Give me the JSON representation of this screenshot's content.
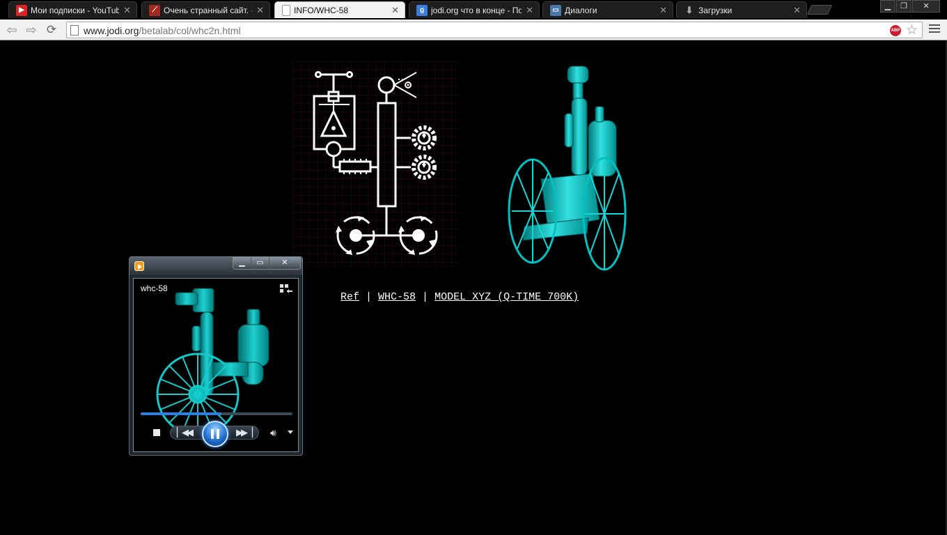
{
  "browser": {
    "tabs": [
      {
        "title": "Мои подписки - YouTube",
        "icon": "youtube-icon",
        "active": false
      },
      {
        "title": "Очень странный сайт. - D",
        "icon": "dota-icon",
        "active": false
      },
      {
        "title": "INFO/WHC-58",
        "icon": "page-icon",
        "active": true
      },
      {
        "title": "jodi.org что в конце - Пои",
        "icon": "google-icon",
        "active": false
      },
      {
        "title": "Диалоги",
        "icon": "dialogs-icon",
        "active": false
      },
      {
        "title": "Загрузки",
        "icon": "download-icon",
        "active": false
      }
    ],
    "address": {
      "domain": "www.jodi.org",
      "path": "/betalab/col/whc2n.html"
    },
    "adblock_label": "ABP"
  },
  "page": {
    "links": {
      "ref": "Ref",
      "whc": "WHC-58",
      "model": "MODEL XYZ (Q-TIME 700K)",
      "separator": "|"
    }
  },
  "player": {
    "title": "whc-58",
    "progress_fraction": 0.53,
    "accent": "#2f7fe0"
  },
  "colors": {
    "cyan_render": "#00b8b8",
    "schematic_grid": "#3a0a0a"
  }
}
